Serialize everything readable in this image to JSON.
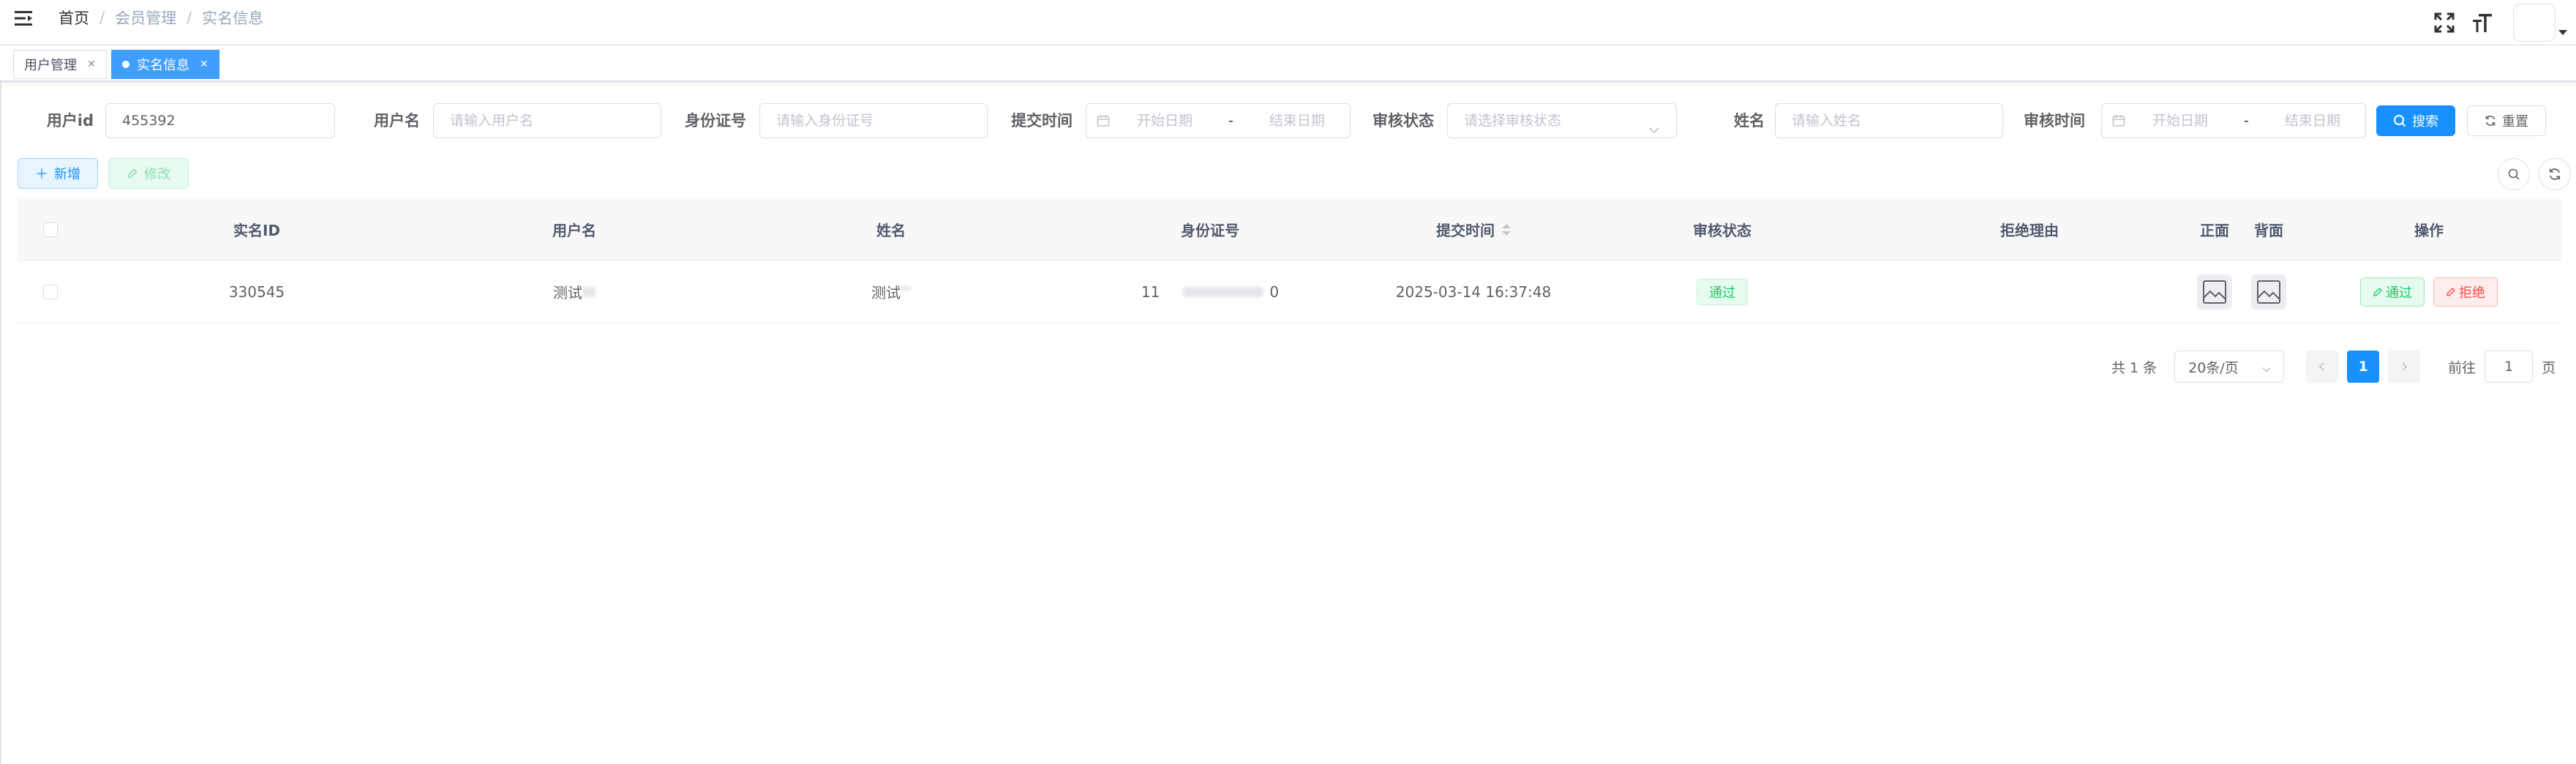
{
  "navbar": {
    "breadcrumb": [
      "首页",
      "会员管理",
      "实名信息"
    ],
    "separator": "/"
  },
  "tags": [
    {
      "label": "用户管理",
      "active": false
    },
    {
      "label": "实名信息",
      "active": true
    }
  ],
  "search": {
    "user_id": {
      "label": "用户id",
      "value": "455392"
    },
    "username": {
      "label": "用户名",
      "placeholder": "请输入用户名"
    },
    "id_card": {
      "label": "身份证号",
      "placeholder": "请输入身份证号"
    },
    "submit_time": {
      "label": "提交时间",
      "start_placeholder": "开始日期",
      "end_placeholder": "结束日期",
      "separator": "-"
    },
    "audit_status": {
      "label": "审核状态",
      "placeholder": "请选择审核状态"
    },
    "name": {
      "label": "姓名",
      "placeholder": "请输入姓名"
    },
    "audit_time": {
      "label": "审核时间",
      "start_placeholder": "开始日期",
      "end_placeholder": "结束日期",
      "separator": "-"
    },
    "search_button": "搜索",
    "reset_button": "重置"
  },
  "toolbar": {
    "add_button": "新增",
    "edit_button": "修改"
  },
  "table": {
    "columns": [
      "实名ID",
      "用户名",
      "姓名",
      "身份证号",
      "提交时间",
      "审核状态",
      "拒绝理由",
      "正面",
      "背面",
      "操作"
    ],
    "rows": [
      {
        "real_name_id": "330545",
        "username": "测试",
        "name": "测试",
        "id_card_prefix": "11",
        "id_card_suffix": "0",
        "submit_time": "2025-03-14 16:37:48",
        "audit_status": "通过",
        "reject_reason": "",
        "op_pass": "通过",
        "op_reject": "拒绝"
      }
    ]
  },
  "pagination": {
    "total": "共 1 条",
    "page_size": "20条/页",
    "current_page": "1",
    "goto_label": "前往",
    "goto_value": "1",
    "page_unit": "页"
  },
  "colors": {
    "primary": "#1890ff",
    "success": "#13ce66",
    "danger": "#ff4949"
  }
}
